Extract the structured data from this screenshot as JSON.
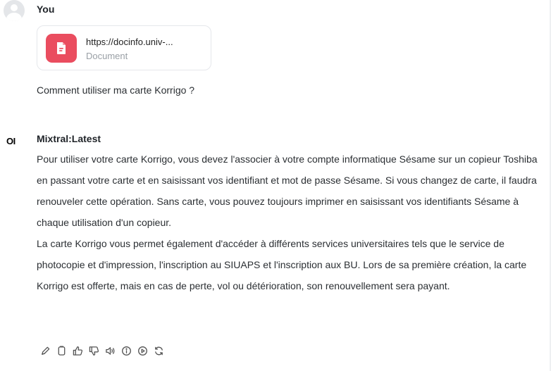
{
  "user_message": {
    "author": "You",
    "attachment": {
      "title": "https://docinfo.univ-...",
      "type": "Document",
      "icon": "document-icon",
      "color": "#ea4d5f"
    },
    "text": "Comment utiliser ma carte Korrigo ?"
  },
  "assistant_message": {
    "logo": "OI",
    "author": "Mixtral:Latest",
    "paragraphs": [
      "Pour utiliser votre carte Korrigo, vous devez l'associer à votre compte informatique Sésame sur un copieur Toshiba en passant votre carte et en saisissant vos identifiant et mot de passe Sésame. Si vous changez de carte, il faudra renouveler cette opération. Sans carte, vous pouvez toujours imprimer en saisissant vos identifiants Sésame à chaque utilisation d'un copieur.",
      "La carte Korrigo vous permet également d'accéder à différents services universitaires tels que le service de photocopie et d'impression, l'inscription au SIUAPS et l'inscription aux BU. Lors de sa première création, la carte Korrigo est offerte, mais en cas de perte, vol ou détérioration, son renouvellement sera payant."
    ],
    "actions": [
      {
        "icon": "pencil-icon"
      },
      {
        "icon": "copy-icon"
      },
      {
        "icon": "thumbs-up-icon"
      },
      {
        "icon": "thumbs-down-icon"
      },
      {
        "icon": "speaker-icon"
      },
      {
        "icon": "info-icon"
      },
      {
        "icon": "play-icon"
      },
      {
        "icon": "regenerate-icon"
      }
    ]
  }
}
